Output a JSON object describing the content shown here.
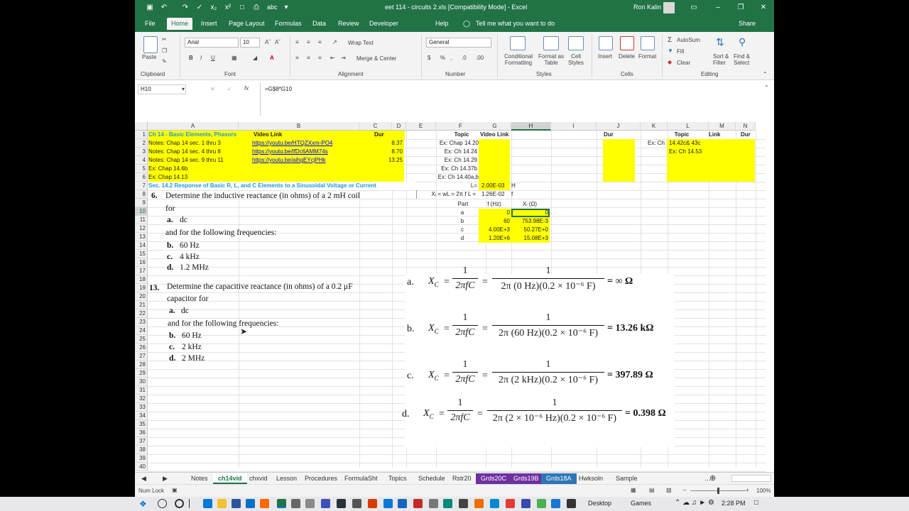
{
  "title": {
    "file": "eet 114 - circuits 2.xls  [Compatibility Mode]  -  Excel",
    "user": "Ron Kalin",
    "autosave": "abc"
  },
  "menu": {
    "tabs": [
      "File",
      "Home",
      "Insert",
      "Page Layout",
      "Formulas",
      "Data",
      "Review",
      "Developer",
      "Help"
    ],
    "tell": "Tell me what you want to do",
    "share": "Share"
  },
  "ribbon": {
    "paste": "Paste",
    "clipboard": "Clipboard",
    "font_name": "Arial",
    "font_size": "10",
    "font_group": "Font",
    "alignment": "Alignment",
    "wrap": "Wrap Text",
    "merge": "Merge & Center",
    "number_format": "General",
    "number": "Number",
    "cond": "Conditional Formatting",
    "fmt_table": "Format as Table",
    "cell_styles": "Cell Styles",
    "styles": "Styles",
    "insert": "Insert",
    "delete": "Delete",
    "format": "Format",
    "cells": "Cells",
    "autosum": "AutoSum",
    "fill": "Fill",
    "clear": "Clear",
    "sort": "Sort & Filter",
    "find": "Find & Select",
    "editing": "Editing",
    "bold": "B",
    "italic": "I",
    "underline": "U"
  },
  "formula_bar": {
    "name_box": "H10",
    "formula": "=G$8*G10"
  },
  "columns": [
    "A",
    "B",
    "C",
    "D",
    "E",
    "F",
    "G",
    "H",
    "I",
    "J",
    "K",
    "L",
    "M",
    "N"
  ],
  "rows": [
    "1",
    "2",
    "3",
    "4",
    "5",
    "6",
    "7",
    "8",
    "9",
    "10",
    "11",
    "12",
    "13",
    "14",
    "15",
    "16",
    "17",
    "18",
    "19",
    "20",
    "21",
    "22",
    "23",
    "24",
    "25",
    "26",
    "27",
    "28",
    "29",
    "30",
    "31",
    "32",
    "33",
    "34",
    "35",
    "36",
    "37",
    "38",
    "39",
    "40"
  ],
  "cells": {
    "a1": "Ch 14 - Basic Elements, Phasors",
    "b1": "Video Link",
    "c1": "Dur",
    "f1": "Topic",
    "g1": "Video Link",
    "j1": "Dur",
    "l1": "Topic",
    "m1": "Link",
    "n1": "Dur",
    "a2": "Notes: Chap 14 sec. 1 thru 3",
    "b2": "https://youtu.be/HTQZXxm-PO4",
    "c2": "8.37",
    "a3": "Notes: Chap 14 sec. 4 thru 8",
    "b3": "https://youtu.be/lfDc6AMM74s",
    "c3": "8.70",
    "a4": "Notes: Chap 14 sec. 9 thru 11",
    "b4": "https://youtu.be/aihgEYcjPHk",
    "c4": "13.25",
    "a5": "Ex: Chap 14.6b",
    "a6": "Ex: Chap 14.13",
    "f2": "Ex: Chap 14.20",
    "f3": "Ex: Ch 14.24",
    "f4": "Ex: Ch 14.29",
    "f5": "Ex: Ch 14.37b",
    "f6": "Ex: Ch 14.40a,b",
    "k2": "Ex: Ch",
    "l2": "14.42c& 43c",
    "l3": "Ex: Ch 14.53",
    "a7": "Sec. 14.2 Response of Basic R, L, and C Elements to a Sinusoidal Voltage or Current",
    "f7": "L=",
    "g7": "2.00E-03",
    "h7": "H",
    "f8": "Xₗ = wL = 2π f L =",
    "g8": "1.26E-02",
    "h8": "f",
    "f9": "Part",
    "g9": "f (Hz)",
    "h9": "Xₗ (Ω)",
    "parts": [
      {
        "p": "a",
        "f": "0",
        "x": "0"
      },
      {
        "p": "b",
        "f": "60",
        "x": "753.98E-3"
      },
      {
        "p": "c",
        "f": "4.00E+3",
        "x": "50.27E+0"
      },
      {
        "p": "d",
        "f": "1.20E+6",
        "x": "15.08E+3"
      }
    ]
  },
  "problem6": {
    "num": "6.",
    "text": "Determine the inductive reactance (in ohms) of a 2 mH coil",
    "for": "for",
    "a": "a.",
    "a_val": "dc",
    "and": "and for the following frequencies:",
    "b": "b.",
    "b_val": "60 Hz",
    "c": "c.",
    "c_val": "4 kHz",
    "d": "d.",
    "d_val": "1.2 MHz"
  },
  "problem13": {
    "num": "13.",
    "text": "Determine the capacitive reactance (in ohms) of a 0.2 μF",
    "text2": "capacitor for",
    "a": "a.",
    "a_val": "dc",
    "and": "and for the following frequencies:",
    "b": "b.",
    "b_val": "60 Hz",
    "c": "c.",
    "c_val": "2 kHz",
    "d": "d.",
    "d_val": "2 MHz"
  },
  "solutions": [
    {
      "label": "a.",
      "den": "2π (0 Hz)(0.2 × 10⁻⁶ F)",
      "result": "= ∞ Ω"
    },
    {
      "label": "b.",
      "den": "2π (60 Hz)(0.2 × 10⁻⁶ F)",
      "result": "= 13.26 kΩ"
    },
    {
      "label": "c.",
      "den": "2π (2 kHz)(0.2 × 10⁻⁶ F)",
      "result": "= 397.89 Ω"
    },
    {
      "label": "d.",
      "den": "2π (2 × 10⁻⁶ Hz)(0.2 × 10⁻⁶ F)",
      "result": "= 0.398 Ω"
    }
  ],
  "sol_common": {
    "xc": "X",
    "sub": "C",
    "one": "1",
    "twopifc": "2πfC",
    "eq": "="
  },
  "sheets": [
    "Notes",
    "ch14vid",
    "chxvid",
    "Lesson",
    "Procedures",
    "FormulaSht",
    "Topics",
    "Schedule",
    "Rstr20",
    "Grds20C",
    "Grds19B",
    "Grds18A",
    "Hwksoln",
    "Sample"
  ],
  "sheet_colors": {
    "Grds20C": "#7030a0",
    "Grds19B": "#7030a0",
    "Grds18A": "#2e75b6"
  },
  "status": {
    "mode": "Num Lock",
    "zoom": "100%"
  },
  "taskbar": {
    "desktop": "Desktop",
    "games": "Games",
    "time": "2:28 PM"
  }
}
